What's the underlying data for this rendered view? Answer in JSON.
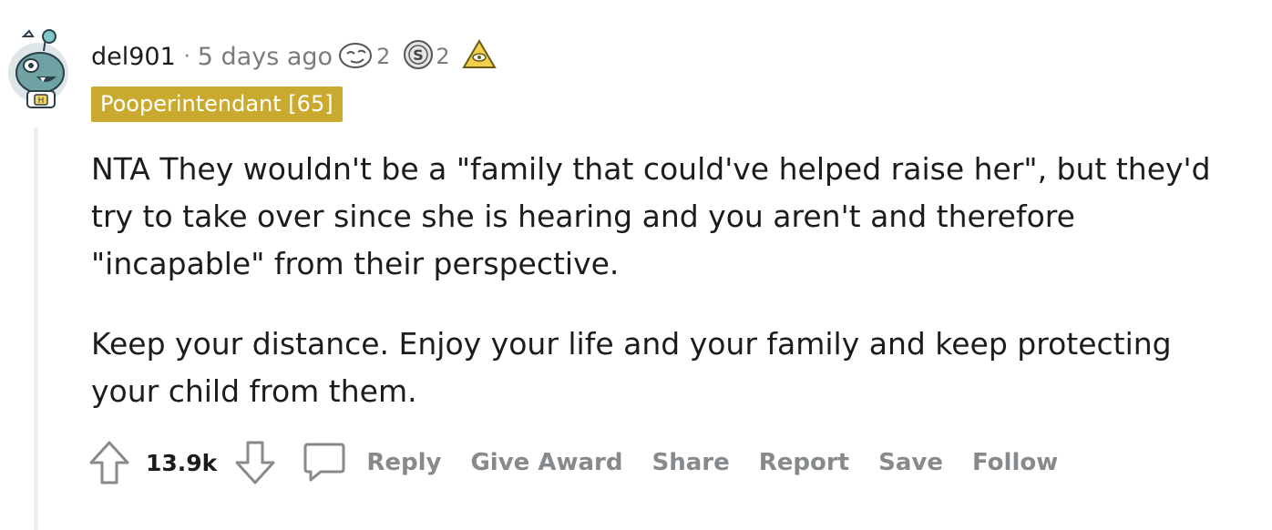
{
  "comment": {
    "username": "del901",
    "separator": "·",
    "timestamp": "5 days ago",
    "awards": [
      {
        "icon": "face-award-icon",
        "count": "2"
      },
      {
        "icon": "silver-coin-award-icon",
        "count": "2"
      },
      {
        "icon": "illuminati-award-icon",
        "count": ""
      }
    ],
    "flair": "Pooperintendant [65]",
    "paragraphs": [
      "NTA They wouldn't be a \"family that could've helped raise her\", but they'd try to take over since she is hearing and you aren't and therefore \"incapable\" from their perspective.",
      "Keep your distance. Enjoy your life and your family and keep protecting your child from them."
    ],
    "score": "13.9k",
    "actions": {
      "reply": "Reply",
      "give_award": "Give Award",
      "share": "Share",
      "report": "Report",
      "save": "Save",
      "follow": "Follow"
    }
  },
  "colors": {
    "flair_bg": "#c9aa2e",
    "meta_text": "#7c7c7c",
    "action_text": "#878a8c",
    "thread_line": "#edeff1"
  }
}
